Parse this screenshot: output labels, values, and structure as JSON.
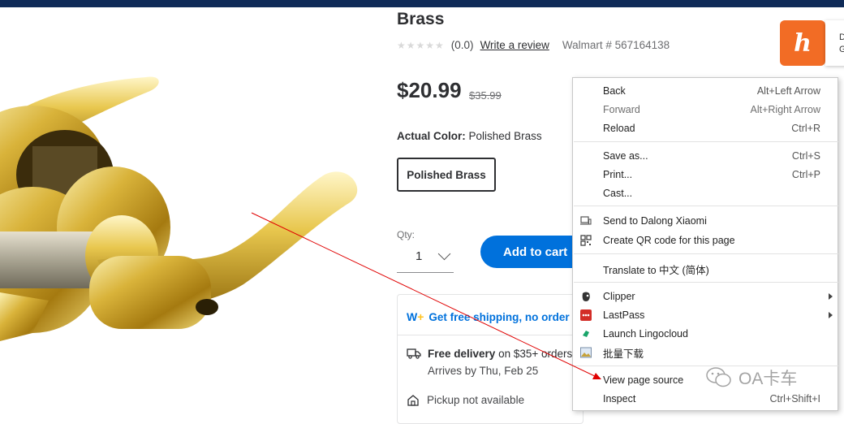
{
  "product": {
    "title": "Brass",
    "rating_text": "(0.0)",
    "stars": "★★★★★",
    "write_review": "Write a review",
    "walmart_number": "Walmart # 567164138",
    "price": "$20.99",
    "was_price": "$35.99",
    "color_label": "Actual Color:",
    "color_value": "Polished Brass",
    "swatch_label": "Polished Brass",
    "qty_label": "Qty:",
    "qty_value": "1",
    "add_to_cart": "Add to cart"
  },
  "fulfillment": {
    "free_shipping": "Get free shipping, no order",
    "free_delivery_bold": "Free delivery",
    "free_delivery_rest": "on $35+ orders",
    "arrives": "Arrives by Thu, Feb 25",
    "pickup": "Pickup not available"
  },
  "honey": {
    "logo_letter": "h",
    "tab_line1": "D",
    "tab_line2": "G"
  },
  "context_menu": {
    "back": {
      "label": "Back",
      "shortcut": "Alt+Left Arrow"
    },
    "forward": {
      "label": "Forward",
      "shortcut": "Alt+Right Arrow"
    },
    "reload": {
      "label": "Reload",
      "shortcut": "Ctrl+R"
    },
    "save_as": {
      "label": "Save as...",
      "shortcut": "Ctrl+S"
    },
    "print": {
      "label": "Print...",
      "shortcut": "Ctrl+P"
    },
    "cast": {
      "label": "Cast..."
    },
    "send_to": {
      "label": "Send to Dalong Xiaomi"
    },
    "qr_code": {
      "label": "Create QR code for this page"
    },
    "translate": {
      "label": "Translate to 中文 (简体)"
    },
    "clipper": {
      "label": "Clipper"
    },
    "lastpass": {
      "label": "LastPass"
    },
    "lingocloud": {
      "label": "Launch Lingocloud"
    },
    "batch_download": {
      "label": "批量下载"
    },
    "view_source": {
      "label": "View page source"
    },
    "inspect": {
      "label": "Inspect",
      "shortcut": "Ctrl+Shift+I"
    }
  },
  "watermark": {
    "text": "OA卡车"
  },
  "colors": {
    "walmart_blue": "#0071dc",
    "header_navy": "#0f2b58",
    "honey_orange": "#f26c25",
    "annotation_red": "#e00000"
  }
}
